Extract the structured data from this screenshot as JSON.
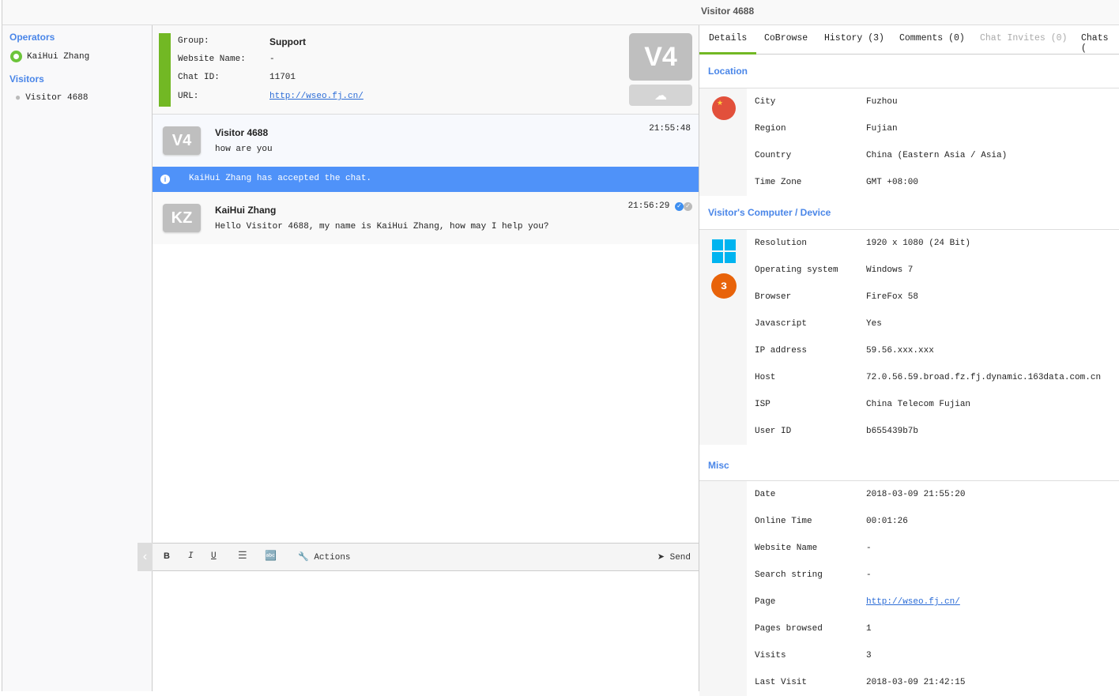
{
  "header": {
    "title": "Visitor 4688"
  },
  "sidebar": {
    "operators_label": "Operators",
    "operators": [
      {
        "name": "KaiHui Zhang"
      }
    ],
    "visitors_label": "Visitors",
    "visitors": [
      {
        "name": "Visitor 4688"
      }
    ]
  },
  "chat_info": {
    "rows": [
      {
        "label": "Group:",
        "value": "Support"
      },
      {
        "label": "Website Name:",
        "value": "-"
      },
      {
        "label": "Chat ID:",
        "value": "11701"
      },
      {
        "label": "URL:",
        "value": "http://wseo.fj.cn/"
      }
    ],
    "avatar": "V4",
    "accent": "#72b824"
  },
  "messages": [
    {
      "avatar": "V4",
      "name": "Visitor 4688",
      "text": "how are you",
      "time": "21:55:48"
    },
    {
      "system": "KaiHui Zhang has accepted the chat."
    },
    {
      "avatar": "KZ",
      "name": "KaiHui Zhang",
      "text": "Hello Visitor 4688, my name is KaiHui Zhang, how may I help you?",
      "time": "21:56:29"
    }
  ],
  "toolbar": {
    "bold": "B",
    "italic": "I",
    "underline": "U",
    "actions": "Actions",
    "send": "Send"
  },
  "tabs": [
    {
      "label": "Details",
      "active": true
    },
    {
      "label": "CoBrowse"
    },
    {
      "label": "History (3)"
    },
    {
      "label": "Comments (0)"
    },
    {
      "label": "Chat Invites (0)",
      "disabled": true
    },
    {
      "label": "Chats ("
    }
  ],
  "details": {
    "location": {
      "title": "Location",
      "rows": [
        {
          "k": "City",
          "v": "Fuzhou"
        },
        {
          "k": "Region",
          "v": "Fujian"
        },
        {
          "k": "Country",
          "v": "China (Eastern Asia / Asia)"
        },
        {
          "k": "Time Zone",
          "v": "GMT +08:00"
        }
      ]
    },
    "device": {
      "title": "Visitor's Computer / Device",
      "rows": [
        {
          "k": "Resolution",
          "v": "1920 x 1080 (24 Bit)"
        },
        {
          "k": "Operating system",
          "v": "Windows 7"
        },
        {
          "k": "Browser",
          "v": "FireFox 58"
        },
        {
          "k": "Javascript",
          "v": "Yes"
        },
        {
          "k": "IP address",
          "v": "59.56.xxx.xxx"
        },
        {
          "k": "Host",
          "v": "72.0.56.59.broad.fz.fj.dynamic.163data.com.cn"
        },
        {
          "k": "ISP",
          "v": "China Telecom Fujian"
        },
        {
          "k": "User ID",
          "v": "b655439b7b"
        }
      ]
    },
    "misc": {
      "title": "Misc",
      "rows": [
        {
          "k": "Date",
          "v": "2018-03-09 21:55:20"
        },
        {
          "k": "Online Time",
          "v": "00:01:26"
        },
        {
          "k": "Website Name",
          "v": "-"
        },
        {
          "k": "Search string",
          "v": "-"
        },
        {
          "k": "Page",
          "v": "http://wseo.fj.cn/",
          "link": true
        },
        {
          "k": "Pages browsed",
          "v": "1"
        },
        {
          "k": "Visits",
          "v": "3"
        },
        {
          "k": "Last Visit",
          "v": "2018-03-09 21:42:15"
        }
      ]
    }
  }
}
